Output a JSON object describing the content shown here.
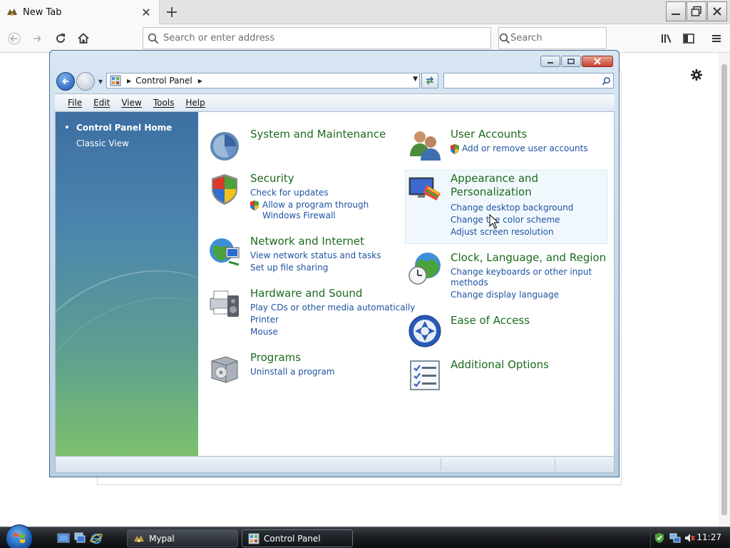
{
  "browser": {
    "tab_title": "New Tab",
    "url_placeholder": "Search or enter address",
    "search_placeholder": "Search"
  },
  "window": {
    "breadcrumb": "Control Panel"
  },
  "menu": [
    "File",
    "Edit",
    "View",
    "Tools",
    "Help"
  ],
  "sidebar": {
    "home": "Control Panel Home",
    "classic": "Classic View"
  },
  "categories": {
    "system": {
      "title": "System and Maintenance"
    },
    "security": {
      "title": "Security",
      "links": [
        "Check for updates",
        "Allow a program through Windows Firewall"
      ]
    },
    "network": {
      "title": "Network and Internet",
      "links": [
        "View network status and tasks",
        "Set up file sharing"
      ]
    },
    "hardware": {
      "title": "Hardware and Sound",
      "links": [
        "Play CDs or other media automatically",
        "Printer",
        "Mouse"
      ]
    },
    "programs": {
      "title": "Programs",
      "links": [
        "Uninstall a program"
      ]
    },
    "users": {
      "title": "User Accounts",
      "links": [
        "Add or remove user accounts"
      ]
    },
    "appearance": {
      "title": "Appearance and Personalization",
      "links": [
        "Change desktop background",
        "Change the color scheme",
        "Adjust screen resolution"
      ]
    },
    "clock": {
      "title": "Clock, Language, and Region",
      "links": [
        "Change keyboards or other input methods",
        "Change display language"
      ]
    },
    "ease": {
      "title": "Ease of Access"
    },
    "additional": {
      "title": "Additional Options"
    }
  },
  "taskbar": {
    "tasks": [
      "Mypal",
      "Control Panel"
    ],
    "clock": "11:27"
  },
  "colors": {
    "category_title": "#1c6a1c",
    "category_link": "#1f53a3",
    "sidebar_top": "#3d6fa3",
    "sidebar_bottom": "#7cc06d"
  }
}
